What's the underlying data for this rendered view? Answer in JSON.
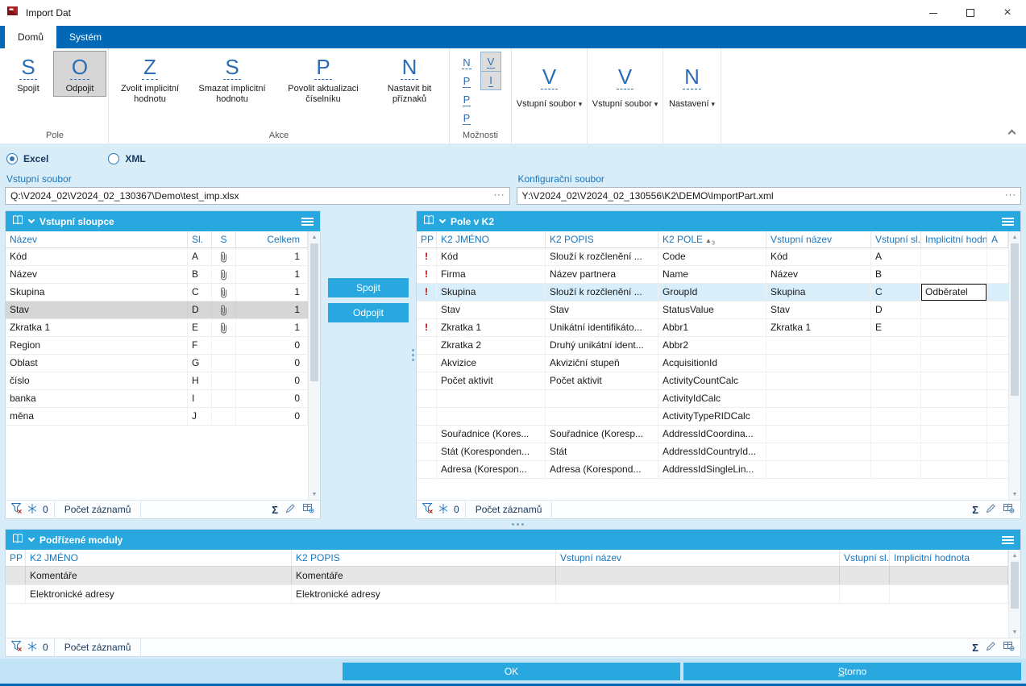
{
  "window": {
    "title": "Import Dat"
  },
  "icons": {
    "close": "×",
    "scroll_up": "▲",
    "scroll_down": "▼",
    "sigma": "Σ",
    "browse": "···",
    "caret": "▾"
  },
  "ribbon": {
    "tabs": [
      {
        "label": "Domů"
      },
      {
        "label": "Systém"
      }
    ],
    "groups": [
      {
        "label": "Pole",
        "buttons": [
          {
            "letter": "S",
            "label": "Spojit"
          },
          {
            "letter": "O",
            "label": "Odpojit"
          }
        ]
      },
      {
        "label": "Akce",
        "buttons": [
          {
            "letter": "Z",
            "label": "Zvolit implicitní hodnotu"
          },
          {
            "letter": "S",
            "label": "Smazat implicitní hodnotu"
          },
          {
            "letter": "P",
            "label": "Povolit aktualizaci číselníku"
          },
          {
            "letter": "N",
            "label": "Nastavit bit příznaků"
          }
        ]
      },
      {
        "label": "Možnosti",
        "small": [
          "N",
          "V",
          "P",
          "I",
          "P",
          "P"
        ]
      }
    ],
    "dropdowns": [
      {
        "letter": "V",
        "label": "Vstupní soubor"
      },
      {
        "letter": "V",
        "label": "Vstupní soubor"
      },
      {
        "letter": "N",
        "label": "Nastavení"
      }
    ]
  },
  "source": {
    "options": [
      {
        "label": "Excel",
        "selected": true
      },
      {
        "label": "XML",
        "selected": false
      }
    ]
  },
  "files": {
    "input_label": "Vstupní soubor",
    "input_value": "Q:\\V2024_02\\V2024_02_130367\\Demo\\test_imp.xlsx",
    "config_label": "Konfigurační soubor",
    "config_value": "Y:\\V2024_02\\V2024_02_130556\\K2\\DEMO\\ImportPart.xml"
  },
  "left_panel": {
    "title": "Vstupní sloupce",
    "columns": [
      "Název",
      "Sl.",
      "S",
      "Celkem"
    ],
    "selected_index": 3,
    "rows": [
      [
        "Kód",
        "A",
        true,
        "1"
      ],
      [
        "Název",
        "B",
        true,
        "1"
      ],
      [
        "Skupina",
        "C",
        true,
        "1"
      ],
      [
        "Stav",
        "D",
        true,
        "1"
      ],
      [
        "Zkratka 1",
        "E",
        true,
        "1"
      ],
      [
        "Region",
        "F",
        false,
        "0"
      ],
      [
        "Oblast",
        "G",
        false,
        "0"
      ],
      [
        "číslo",
        "H",
        false,
        "0"
      ],
      [
        "banka",
        "I",
        false,
        "0"
      ],
      [
        "měna",
        "J",
        false,
        "0"
      ]
    ]
  },
  "middle": {
    "spojit": "Spojit",
    "odpojit": "Odpojit"
  },
  "right_panel": {
    "title": "Pole v K2",
    "columns": [
      "PP",
      "K2 JMÉNO",
      "K2 POPIS",
      "K2 POLE",
      "Vstupní název",
      "Vstupní sl.",
      "Implicitní hodnota",
      "A"
    ],
    "sort": {
      "arrow": "▲",
      "order": "3"
    },
    "selected_index": 2,
    "edit_cell": {
      "row": 2,
      "col": 6
    },
    "rows": [
      [
        "!",
        "Kód",
        "Slouží k rozčlenění ...",
        "Code",
        "Kód",
        "A",
        ""
      ],
      [
        "!",
        "Firma",
        "Název partnera",
        "Name",
        "Název",
        "B",
        ""
      ],
      [
        "!",
        "Skupina",
        "Slouží k rozčlenění ...",
        "GroupId",
        "Skupina",
        "C",
        "Odběratel"
      ],
      [
        "",
        "Stav",
        "Stav",
        "StatusValue",
        "Stav",
        "D",
        ""
      ],
      [
        "!",
        "Zkratka 1",
        "Unikátní identifikáto...",
        "Abbr1",
        "Zkratka 1",
        "E",
        ""
      ],
      [
        "",
        "Zkratka 2",
        "Druhý unikátní ident...",
        "Abbr2",
        "",
        "",
        ""
      ],
      [
        "",
        "Akvizice",
        "Akviziční stupeň",
        "AcquisitionId",
        "",
        "",
        ""
      ],
      [
        "",
        "Počet aktivit",
        "Počet aktivit",
        "ActivityCountCalc",
        "",
        "",
        ""
      ],
      [
        "",
        "",
        "",
        "ActivityIdCalc",
        "",
        "",
        ""
      ],
      [
        "",
        "",
        "",
        "ActivityTypeRIDCalc",
        "",
        "",
        ""
      ],
      [
        "",
        "Souřadnice (Kores...",
        "Souřadnice (Koresp...",
        "AddressIdCoordina...",
        "",
        "",
        ""
      ],
      [
        "",
        "Stát (Koresponden...",
        "Stát",
        "AddressIdCountryId...",
        "",
        "",
        ""
      ],
      [
        "",
        "Adresa (Korespon...",
        "Adresa (Korespond...",
        "AddressIdSingleLin...",
        "",
        "",
        ""
      ]
    ]
  },
  "bottom_panel": {
    "title": "Podřízené moduly",
    "columns": [
      "PP",
      "K2 JMÉNO",
      "K2 POPIS",
      "Vstupní název",
      "Vstupní sl.",
      "Implicitní hodnota"
    ],
    "selected_index": 0,
    "rows": [
      [
        "",
        "Komentáře",
        "Komentáře",
        "",
        "",
        ""
      ],
      [
        "",
        "Elektronické adresy",
        "Elektronické adresy",
        "",
        "",
        ""
      ]
    ]
  },
  "statusbar": {
    "count": "0",
    "records_label": "Počet záznamů"
  },
  "footer": {
    "ok": "OK",
    "cancel": "Storno"
  }
}
